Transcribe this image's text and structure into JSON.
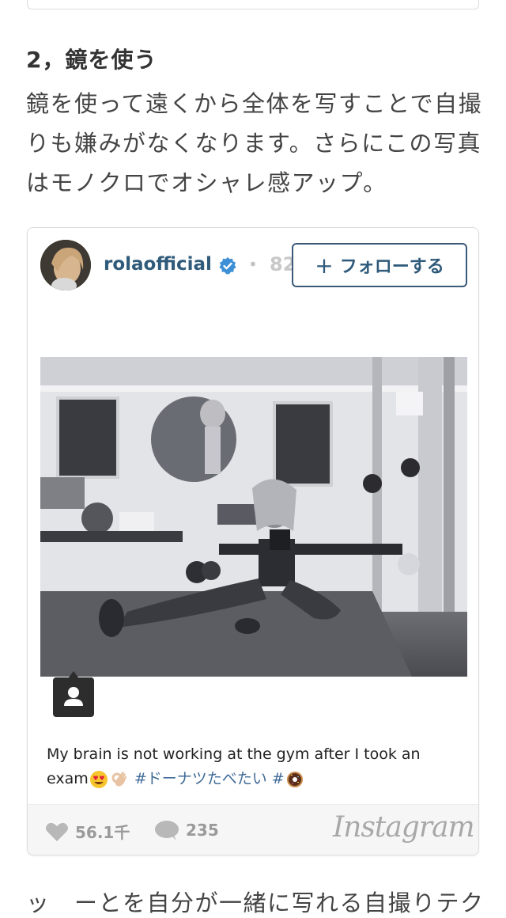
{
  "section": {
    "heading": "2，鏡を使う",
    "body": "鏡を使って遠くから全体を写すことで自撮りも嫌みがなくなります。さらにこの写真はモノクロでオシャレ感アップ。"
  },
  "embed": {
    "username": "rolaofficial",
    "count_partial": "82",
    "follow_label": "フォローする",
    "caption_text": "My brain is not working at the gym after I took an exam",
    "caption_emojis": [
      "heart-eyes-emoji",
      "ok-hand-emoji"
    ],
    "hashtag1": "#ドーナツたべたい",
    "hashtag2": "#",
    "hashtag2_emoji": "donut-emoji",
    "likes": "56.1千",
    "comments": "235",
    "brand": "Instagram"
  },
  "next_paragraph_partial": "ッ　ーとを自分が一緒に写れる自撮りテク",
  "colors": {
    "username": "#2f5a7a",
    "hashtag": "#3f6a97",
    "verified": "#3d8fd6",
    "footer_bg": "#f6f6f6"
  }
}
